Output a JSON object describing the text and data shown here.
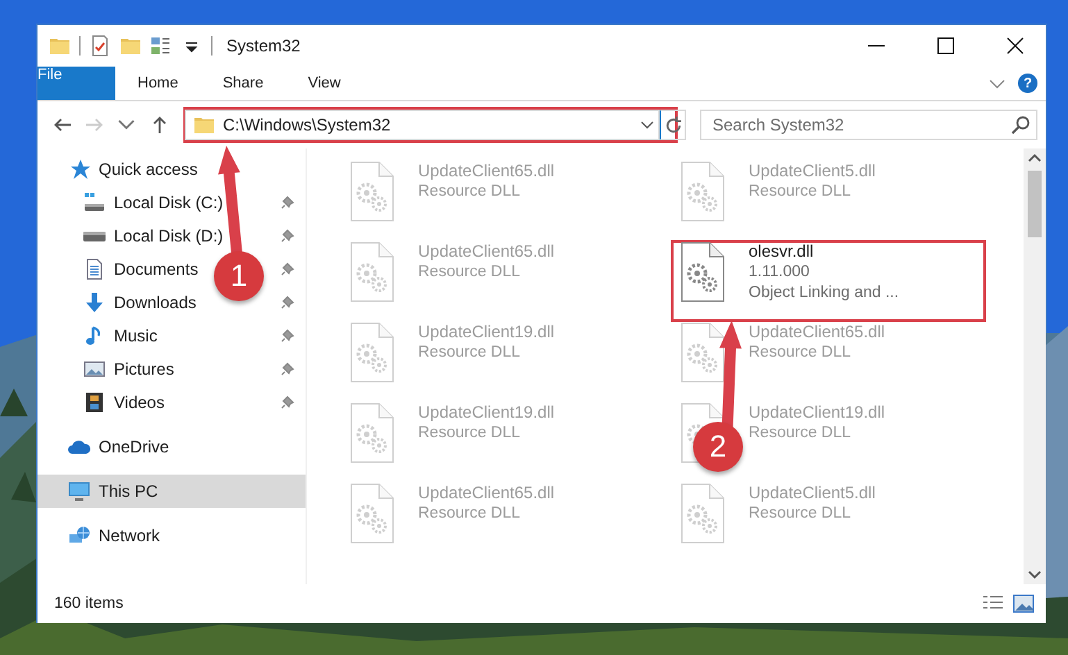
{
  "window": {
    "title": "System32",
    "quick_toolbar": [
      {
        "kind": "folder"
      },
      {
        "kind": "properties"
      },
      {
        "kind": "new-folder"
      },
      {
        "kind": "customize"
      }
    ]
  },
  "ribbon": {
    "tabs": [
      {
        "label": "File",
        "kind": "file",
        "selected": false
      },
      {
        "label": "Home",
        "kind": "tab",
        "selected": false
      },
      {
        "label": "Share",
        "kind": "tab",
        "selected": false
      },
      {
        "label": "View",
        "kind": "tab",
        "selected": false
      }
    ],
    "help": "?"
  },
  "address_bar": {
    "path": "C:\\Windows\\System32"
  },
  "search": {
    "placeholder": "Search System32"
  },
  "sidebar": {
    "items": [
      {
        "label": "Quick access",
        "kind": "star",
        "selected": false,
        "children": [
          {
            "label": "Local Disk (C:)",
            "kind": "drive-c",
            "selected": false,
            "pinned": true
          },
          {
            "label": "Local Disk (D:)",
            "kind": "drive",
            "selected": false,
            "pinned": true
          },
          {
            "label": "Documents",
            "kind": "document",
            "selected": false,
            "pinned": true
          },
          {
            "label": "Downloads",
            "kind": "download",
            "selected": false,
            "pinned": true
          },
          {
            "label": "Music",
            "kind": "music",
            "selected": false,
            "pinned": true
          },
          {
            "label": "Pictures",
            "kind": "pictures",
            "selected": false,
            "pinned": true
          },
          {
            "label": "Videos",
            "kind": "videos",
            "selected": false,
            "pinned": true
          }
        ]
      },
      {
        "label": "OneDrive",
        "kind": "cloud",
        "selected": false
      },
      {
        "label": "This PC",
        "kind": "computer",
        "selected": true
      },
      {
        "label": "Network",
        "kind": "network",
        "selected": false
      }
    ]
  },
  "files": [
    {
      "name": "UpdateClient65.dll",
      "details": [
        "Resource DLL"
      ],
      "dimmed": true
    },
    {
      "name": "UpdateClient5.dll",
      "details": [
        "Resource DLL"
      ],
      "dimmed": true
    },
    {
      "name": "UpdateClient65.dll",
      "details": [
        "Resource DLL"
      ],
      "dimmed": true
    },
    {
      "name": "olesvr.dll",
      "details": [
        "1.11.000",
        "Object Linking and ..."
      ],
      "dimmed": false
    },
    {
      "name": "UpdateClient19.dll",
      "details": [
        "Resource DLL"
      ],
      "dimmed": true
    },
    {
      "name": "UpdateClient65.dll",
      "details": [
        "Resource DLL"
      ],
      "dimmed": true
    },
    {
      "name": "UpdateClient19.dll",
      "details": [
        "Resource DLL"
      ],
      "dimmed": true
    },
    {
      "name": "UpdateClient19.dll",
      "details": [
        "Resource DLL"
      ],
      "dimmed": true
    },
    {
      "name": "UpdateClient65.dll",
      "details": [
        "Resource DLL"
      ],
      "dimmed": true
    },
    {
      "name": "UpdateClient5.dll",
      "details": [
        "Resource DLL"
      ],
      "dimmed": true
    }
  ],
  "status_bar": {
    "item_count": "160 items"
  },
  "annotations": [
    {
      "label": "1"
    },
    {
      "label": "2"
    }
  ]
}
